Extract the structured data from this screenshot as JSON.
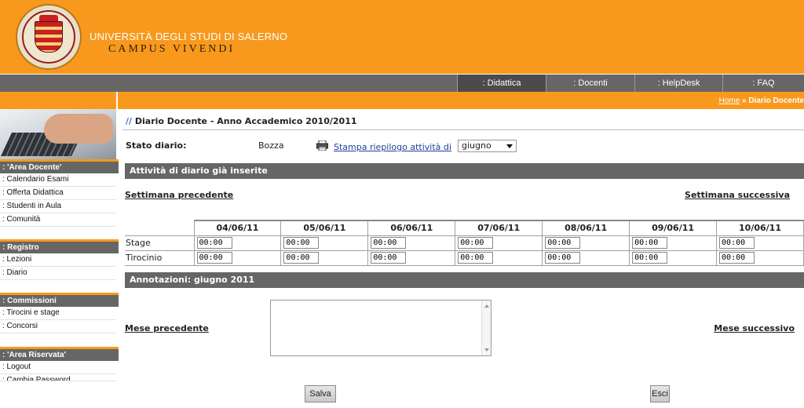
{
  "header": {
    "university": "UNIVERSITÀ DEGLI STUDI DI SALERNO",
    "motto": "CAMPUS VIVENDI",
    "logo_icon": "university-seal-logo",
    "brand_color": "#f8991d"
  },
  "nav": {
    "items": [
      {
        "label": ": Didattica",
        "active": true
      },
      {
        "label": ": Docenti",
        "active": false
      },
      {
        "label": ": HelpDesk",
        "active": false
      },
      {
        "label": ": FAQ",
        "active": false
      }
    ]
  },
  "breadcrumb": {
    "home": "Home",
    "sep": " » ",
    "current": "Diario Docente"
  },
  "sidebar": {
    "sections": [
      {
        "title": ": 'Area Docente'",
        "items": [
          ": Calendario Esami",
          ": Offerta Didattica",
          ": Studenti in Aula",
          ": Comunità"
        ]
      },
      {
        "title": ": Registro",
        "items": [
          ": Lezioni",
          ": Diario"
        ]
      },
      {
        "title": ": Commissioni",
        "items": [
          ": Tirocini e stage",
          ": Concorsi"
        ]
      },
      {
        "title": ": 'Area Riservata'",
        "items": [
          ": Logout",
          ": Cambia Password"
        ]
      }
    ]
  },
  "main": {
    "slashes": "//",
    "title": "Diario Docente - Anno Accademico 2010/2011",
    "stato_label": "Stato diario:",
    "stato_value": "Bozza",
    "print_link": "Stampa riepilogo attività di",
    "month_select": "giugno",
    "section_inserted": "Attività di diario già inserite",
    "prev_week": "Settimana precedente",
    "next_week": "Settimana successiva",
    "dates": [
      "04/06/11",
      "05/06/11",
      "06/06/11",
      "07/06/11",
      "08/06/11",
      "09/06/11",
      "10/06/11"
    ],
    "rows": [
      {
        "label": "Stage",
        "values": [
          "00:00",
          "00:00",
          "00:00",
          "00:00",
          "00:00",
          "00:00",
          "00:00"
        ]
      },
      {
        "label": "Tirocinio",
        "values": [
          "00:00",
          "00:00",
          "00:00",
          "00:00",
          "00:00",
          "00:00",
          "00:00"
        ]
      }
    ],
    "annotations_title": "Annotazioni: giugno 2011",
    "annotations_text": "",
    "prev_month": "Mese precedente",
    "next_month": "Mese successivo",
    "save_button": "Salva",
    "exit_button": "Esci"
  }
}
